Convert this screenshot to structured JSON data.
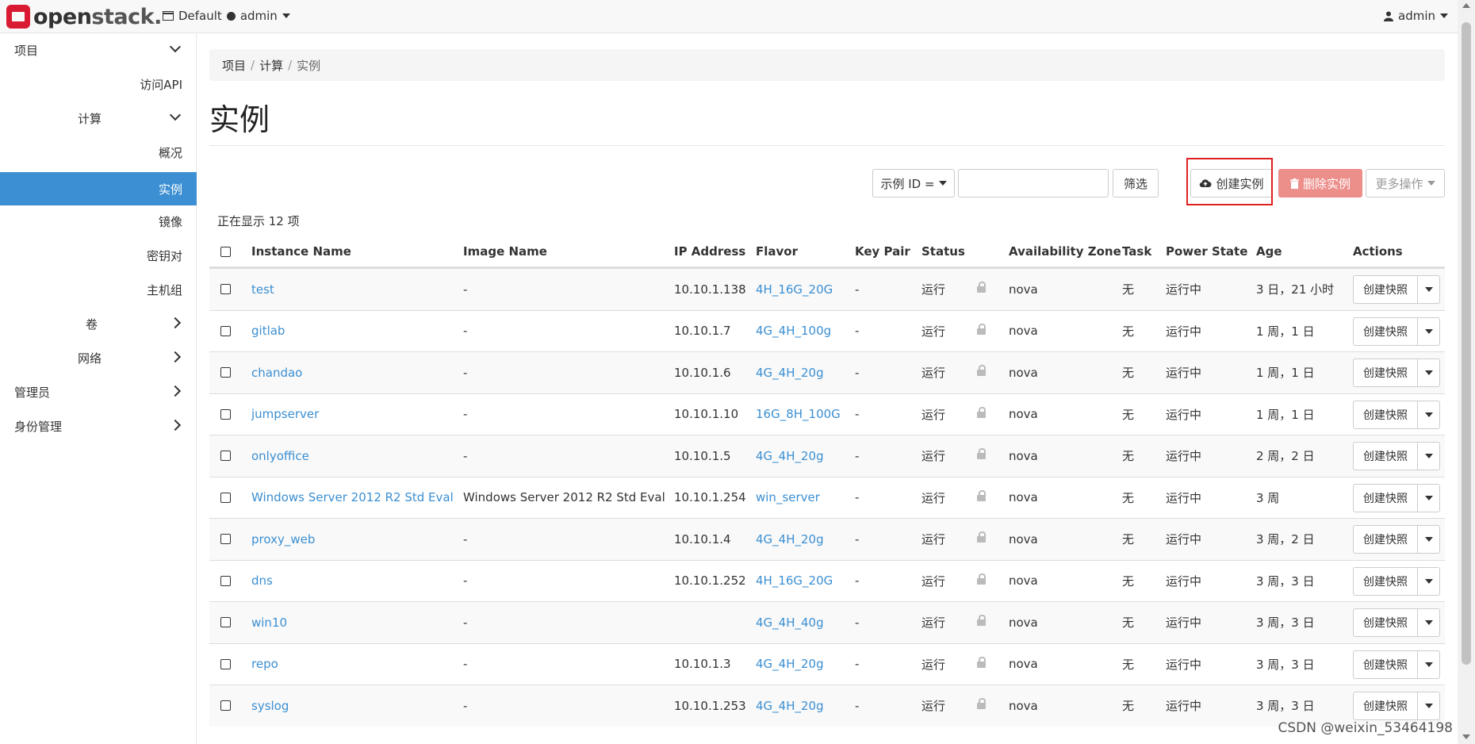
{
  "brand": {
    "name_a": "open",
    "name_b": "stack."
  },
  "topbar": {
    "domain": "Default",
    "project": "admin",
    "user": "admin"
  },
  "sidebar": {
    "items": [
      {
        "label": "项目"
      },
      {
        "label": "访问API"
      },
      {
        "label": "计算"
      },
      {
        "label": "概况"
      },
      {
        "label": "实例"
      },
      {
        "label": "镜像"
      },
      {
        "label": "密钥对"
      },
      {
        "label": "主机组"
      },
      {
        "label": "卷"
      },
      {
        "label": "网络"
      },
      {
        "label": "管理员"
      },
      {
        "label": "身份管理"
      }
    ]
  },
  "breadcrumb": [
    "项目",
    "计算",
    "实例"
  ],
  "breadcrumb_sep": "/",
  "page": {
    "title": "实例",
    "showing": "正在显示 12 项"
  },
  "toolbar": {
    "filter_type": "示例 ID =",
    "search_value": "",
    "filter_label": "筛选",
    "create_label": "创建实例",
    "delete_label": "删除实例",
    "more_label": "更多操作"
  },
  "table": {
    "headers": [
      "Instance Name",
      "Image Name",
      "IP Address",
      "Flavor",
      "Key Pair",
      "Status",
      "Availability Zone",
      "Task",
      "Power State",
      "Age",
      "Actions"
    ],
    "action_label": "创建快照",
    "rows": [
      {
        "name": "test",
        "image": "-",
        "ip": "10.10.1.138",
        "flavor": "4H_16G_20G",
        "key": "-",
        "status": "运行",
        "zone": "nova",
        "task": "无",
        "power": "运行中",
        "age": "3 日，21 小时"
      },
      {
        "name": "gitlab",
        "image": "-",
        "ip": "10.10.1.7",
        "flavor": "4G_4H_100g",
        "key": "-",
        "status": "运行",
        "zone": "nova",
        "task": "无",
        "power": "运行中",
        "age": "1 周，1 日"
      },
      {
        "name": "chandao",
        "image": "-",
        "ip": "10.10.1.6",
        "flavor": "4G_4H_20g",
        "key": "-",
        "status": "运行",
        "zone": "nova",
        "task": "无",
        "power": "运行中",
        "age": "1 周，1 日"
      },
      {
        "name": "jumpserver",
        "image": "-",
        "ip": "10.10.1.10",
        "flavor": "16G_8H_100G",
        "key": "-",
        "status": "运行",
        "zone": "nova",
        "task": "无",
        "power": "运行中",
        "age": "1 周，1 日"
      },
      {
        "name": "onlyoffice",
        "image": "-",
        "ip": "10.10.1.5",
        "flavor": "4G_4H_20g",
        "key": "-",
        "status": "运行",
        "zone": "nova",
        "task": "无",
        "power": "运行中",
        "age": "2 周，2 日"
      },
      {
        "name": "Windows Server 2012 R2 Std Eval",
        "image": "Windows Server 2012 R2 Std Eval",
        "ip": "10.10.1.254",
        "flavor": "win_server",
        "key": "-",
        "status": "运行",
        "zone": "nova",
        "task": "无",
        "power": "运行中",
        "age": "3 周"
      },
      {
        "name": "proxy_web",
        "image": "-",
        "ip": "10.10.1.4",
        "flavor": "4G_4H_20g",
        "key": "-",
        "status": "运行",
        "zone": "nova",
        "task": "无",
        "power": "运行中",
        "age": "3 周，2 日"
      },
      {
        "name": "dns",
        "image": "-",
        "ip": "10.10.1.252",
        "flavor": "4H_16G_20G",
        "key": "-",
        "status": "运行",
        "zone": "nova",
        "task": "无",
        "power": "运行中",
        "age": "3 周，3 日"
      },
      {
        "name": "win10",
        "image": "-",
        "ip": "",
        "flavor": "4G_4H_40g",
        "key": "-",
        "status": "运行",
        "zone": "nova",
        "task": "无",
        "power": "运行中",
        "age": "3 周，3 日"
      },
      {
        "name": "repo",
        "image": "-",
        "ip": "10.10.1.3",
        "flavor": "4G_4H_20g",
        "key": "-",
        "status": "运行",
        "zone": "nova",
        "task": "无",
        "power": "运行中",
        "age": "3 周，3 日"
      },
      {
        "name": "syslog",
        "image": "-",
        "ip": "10.10.1.253",
        "flavor": "4G_4H_20g",
        "key": "-",
        "status": "运行",
        "zone": "nova",
        "task": "无",
        "power": "运行中",
        "age": "3 周，3 日"
      }
    ]
  },
  "watermark": "CSDN @weixin_53464198",
  "colors": {
    "accent": "#3b8fd2",
    "danger": "#ec8f8b",
    "highlight": "#e02020"
  }
}
